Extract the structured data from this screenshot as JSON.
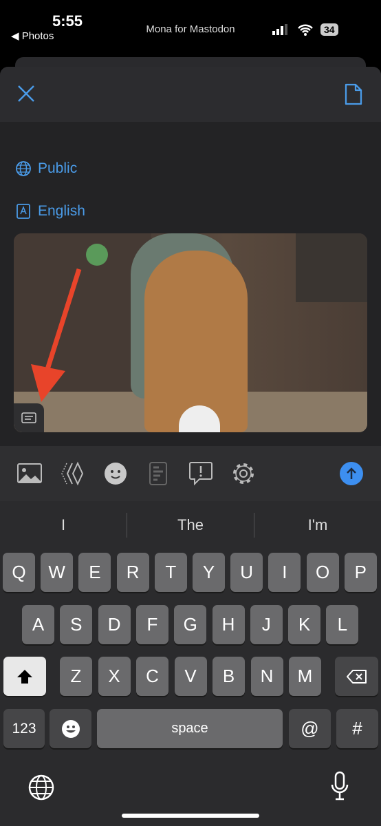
{
  "status": {
    "time": "5:55",
    "back": "◀ Photos",
    "app": "Mona for Mastodon",
    "battery": "34"
  },
  "composer": {
    "visibility": "Public",
    "language": "English"
  },
  "colors": {
    "accent": "#4a9be8",
    "arrow": "#e8442a"
  },
  "toolbar": {
    "icons": [
      "image-icon",
      "content-warning-icon",
      "emoji-icon",
      "alt-text-icon",
      "report-icon",
      "gear-icon",
      "send-icon"
    ]
  },
  "keyboard": {
    "suggestions": [
      "I",
      "The",
      "I'm"
    ],
    "row1": [
      "Q",
      "W",
      "E",
      "R",
      "T",
      "Y",
      "U",
      "I",
      "O",
      "P"
    ],
    "row2": [
      "A",
      "S",
      "D",
      "F",
      "G",
      "H",
      "J",
      "K",
      "L"
    ],
    "row3": [
      "Z",
      "X",
      "C",
      "V",
      "B",
      "N",
      "M"
    ],
    "numbers": "123",
    "space": "space",
    "at": "@",
    "hash": "#"
  }
}
